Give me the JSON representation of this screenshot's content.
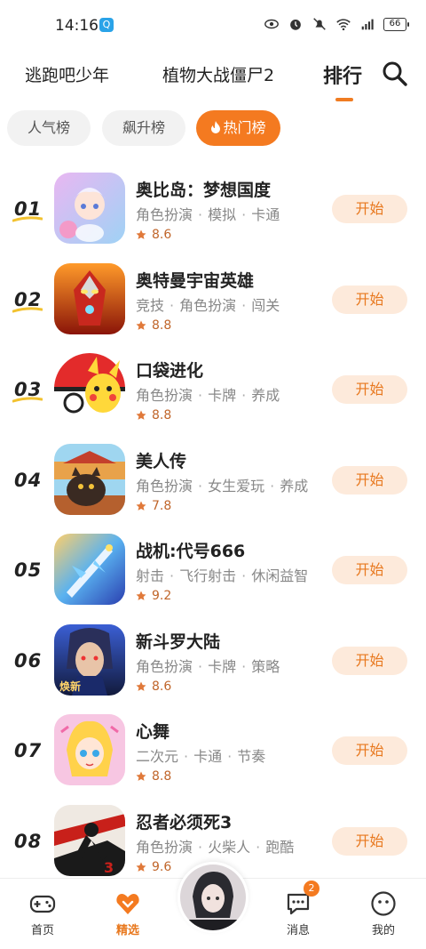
{
  "status": {
    "time": "14:16",
    "battery": "66"
  },
  "top_tabs": [
    {
      "label": "逃跑吧少年"
    },
    {
      "label": "植物大战僵尸2"
    },
    {
      "label": "排行"
    }
  ],
  "chips": [
    {
      "label": "人气榜"
    },
    {
      "label": "飙升榜"
    },
    {
      "label": "热门榜"
    }
  ],
  "games": [
    {
      "rank": "01",
      "name": "奥比岛：梦想国度",
      "tags": [
        "角色扮演",
        "模拟",
        "卡通"
      ],
      "rating": "8.6",
      "button": "开始"
    },
    {
      "rank": "02",
      "name": "奥特曼宇宙英雄",
      "tags": [
        "竞技",
        "角色扮演",
        "闯关"
      ],
      "rating": "8.8",
      "button": "开始"
    },
    {
      "rank": "03",
      "name": "口袋进化",
      "tags": [
        "角色扮演",
        "卡牌",
        "养成"
      ],
      "rating": "8.8",
      "button": "开始"
    },
    {
      "rank": "04",
      "name": "美人传",
      "tags": [
        "角色扮演",
        "女生爱玩",
        "养成"
      ],
      "rating": "7.8",
      "button": "开始"
    },
    {
      "rank": "05",
      "name": "战机:代号666",
      "tags": [
        "射击",
        "飞行射击",
        "休闲益智"
      ],
      "rating": "9.2",
      "button": "开始"
    },
    {
      "rank": "06",
      "name": "新斗罗大陆",
      "tags": [
        "角色扮演",
        "卡牌",
        "策略"
      ],
      "rating": "8.6",
      "button": "开始",
      "icon_badge": "焕新"
    },
    {
      "rank": "07",
      "name": "心舞",
      "tags": [
        "二次元",
        "卡通",
        "节奏"
      ],
      "rating": "8.8",
      "button": "开始"
    },
    {
      "rank": "08",
      "name": "忍者必须死3",
      "tags": [
        "角色扮演",
        "火柴人",
        "跑酷"
      ],
      "rating": "9.6",
      "button": "开始"
    }
  ],
  "bottom_nav": [
    {
      "label": "首页"
    },
    {
      "label": "精选"
    },
    {
      "label": "消息",
      "badge": "2"
    },
    {
      "label": "我的"
    }
  ],
  "colors": {
    "accent": "#f47a20",
    "button_bg": "#fdeadb",
    "rating": "#c0652a",
    "rank_mark": "#f2c230"
  }
}
